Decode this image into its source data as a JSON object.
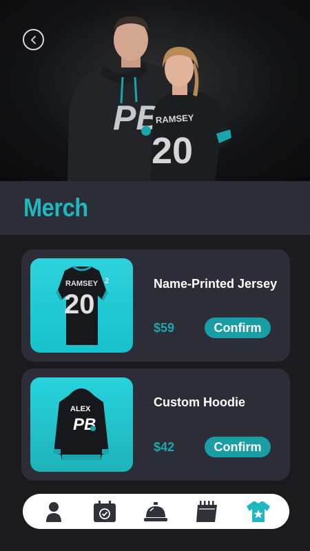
{
  "header": {
    "back_icon": "chevron-left-icon",
    "hero_jersey_name": "RAMSEY",
    "hero_jersey_number": "20",
    "hero_logo": "PB"
  },
  "page": {
    "title": "Merch"
  },
  "products": [
    {
      "name": "Name-Printed Jersey",
      "price": "$59",
      "confirm_label": "Confirm",
      "image_text_name": "RAMSEY",
      "image_text_number": "20"
    },
    {
      "name": "Custom Hoodie",
      "price": "$42",
      "confirm_label": "Confirm",
      "image_text_name": "ALEX",
      "image_text_logo": "PB"
    }
  ],
  "nav": {
    "items": [
      "profile-icon",
      "calendar-check-icon",
      "service-bell-icon",
      "notebook-icon",
      "shirt-star-icon"
    ],
    "active_index": 4
  },
  "colors": {
    "accent": "#1fb8c1",
    "card_bg": "#2c2d36",
    "page_bg": "#1b1b1e",
    "button_bg": "#1a9ea6",
    "nav_bg": "#ffffff",
    "nav_icon": "#30323a"
  }
}
